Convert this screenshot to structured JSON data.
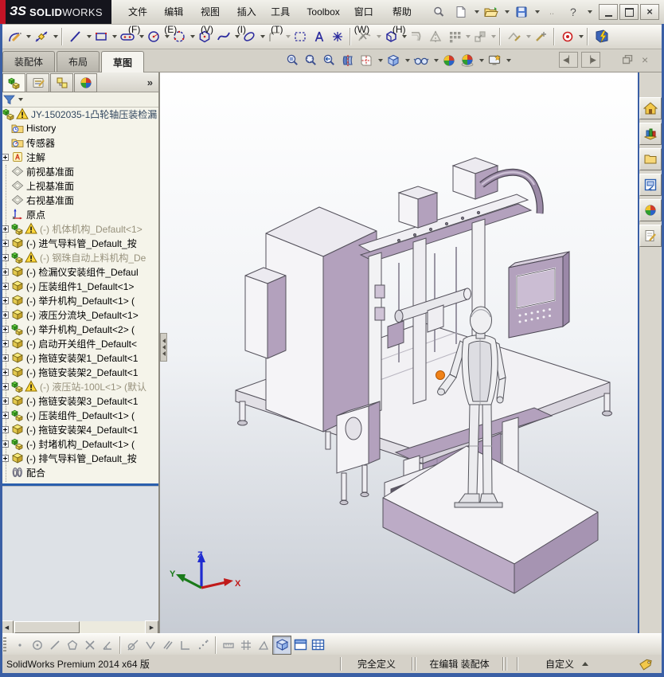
{
  "brand": {
    "mark": "ЗS",
    "name_bold": "SOLID",
    "name_light": "WORKS"
  },
  "menubar": {
    "items": [
      "文件(F)",
      "编辑(E)",
      "视图(V)",
      "插入(I)",
      "工具(T)",
      "Toolbox",
      "窗口(W)",
      "帮助(H)"
    ]
  },
  "quick_access_icons": [
    "search-icon",
    "new-document-icon",
    "open-icon",
    "save-icon",
    "overflow-icon",
    "help-icon"
  ],
  "window_controls": [
    "minimize",
    "maximize",
    "close"
  ],
  "sketch_toolbar_icons": [
    "sketch",
    "smart-dimension",
    "line",
    "corner-rectangle",
    "straight-slot",
    "circle",
    "perimeter-circle",
    "polygon",
    "spline",
    "ellipse",
    "sketch-fillet",
    "selection-box",
    "text",
    "point",
    "trim-entities",
    "convert-entities",
    "offset-entities",
    "mirror-entities",
    "linear-pattern",
    "move-entities",
    "display-relations",
    "repair-sketch",
    "quick-snaps",
    "instant2d"
  ],
  "command_tabs": {
    "items": [
      "装配体",
      "布局",
      "草图"
    ],
    "active": "草图"
  },
  "headsup_icons": [
    "zoom-to-fit",
    "zoom-to-area",
    "previous-view",
    "section-view",
    "view-orientation",
    "display-style",
    "hide-show-items",
    "edit-appearance",
    "apply-scene",
    "view-settings"
  ],
  "doc_window_controls": [
    "previous-window",
    "next-window",
    "minimize",
    "restore",
    "close"
  ],
  "feature_panel": {
    "tabs": [
      "featuremanager",
      "propertymanager",
      "configurationmanager",
      "displaymanager"
    ],
    "overflow": "»",
    "root": {
      "label": "JY-1502035-1凸轮轴压装检漏",
      "warning": true
    },
    "items": [
      {
        "label": "History",
        "icon": "history-folder"
      },
      {
        "label": "传感器",
        "icon": "sensors-folder"
      },
      {
        "label": "注解",
        "icon": "annotations",
        "expandable": true
      },
      {
        "label": "前视基准面",
        "icon": "plane"
      },
      {
        "label": "上视基准面",
        "icon": "plane"
      },
      {
        "label": "右视基准面",
        "icon": "plane"
      },
      {
        "label": "原点",
        "icon": "origin"
      },
      {
        "label": "(-) 机体机构_Default<1>",
        "icon": "subassembly",
        "warning": true,
        "suppressed_look": true,
        "expandable": true
      },
      {
        "label": "(-) 进气导料管_Default_按",
        "icon": "part",
        "expandable": true
      },
      {
        "label": "(-) 钢珠自动上料机构_De",
        "icon": "subassembly",
        "warning": true,
        "suppressed_look": true,
        "expandable": true
      },
      {
        "label": "(-) 检漏仪安装组件_Defaul",
        "icon": "part",
        "expandable": true
      },
      {
        "label": "(-) 压装组件1_Default<1>",
        "icon": "part",
        "expandable": true
      },
      {
        "label": "(-) 举升机构_Default<1> (",
        "icon": "part",
        "expandable": true
      },
      {
        "label": "(-) 液压分流块_Default<1>",
        "icon": "part",
        "expandable": true
      },
      {
        "label": "(-) 举升机构_Default<2> (",
        "icon": "subassembly",
        "expandable": true
      },
      {
        "label": "(-) 启动开关组件_Default<",
        "icon": "part",
        "expandable": true
      },
      {
        "label": "(-) 拖链安装架1_Default<1",
        "icon": "part",
        "expandable": true
      },
      {
        "label": "(-) 拖链安装架2_Default<1",
        "icon": "part",
        "expandable": true
      },
      {
        "label": "(-) 液压站-100L<1> (默认",
        "icon": "subassembly",
        "warning": true,
        "suppressed_look": true,
        "expandable": true
      },
      {
        "label": "(-) 拖链安装架3_Default<1",
        "icon": "part",
        "expandable": true
      },
      {
        "label": "(-) 压装组件_Default<1> (",
        "icon": "subassembly",
        "expandable": true
      },
      {
        "label": "(-) 拖链安装架4_Default<1",
        "icon": "part",
        "expandable": true
      },
      {
        "label": "(-) 封堵机构_Default<1> (",
        "icon": "subassembly",
        "expandable": true
      },
      {
        "label": "(-) 排气导料管_Default_按",
        "icon": "part",
        "expandable": true
      }
    ],
    "mates": {
      "label": "配合",
      "icon": "mates-paperclip"
    }
  },
  "taskpane_icons": [
    "solidworks-resources",
    "design-library",
    "file-explorer",
    "view-palette",
    "appearances-scenes",
    "custom-properties"
  ],
  "snap_toolbar_icons": [
    "sketch-point",
    "circle-snap",
    "line-snap",
    "polygon-snap",
    "intersection-snap",
    "angle-snap",
    "tangent-snap",
    "midpoint-snap",
    "parallel-snap",
    "perpendicular-snap",
    "trace-snap",
    "length-snap",
    "grid-snap",
    "angle-measure",
    "view-cube",
    "split-pane",
    "table-grid"
  ],
  "viewport": {
    "triad": {
      "x_label": "X",
      "y_label": "Y",
      "z_label": "Z"
    },
    "colors": {
      "model_lavender": "#b3a1bd",
      "model_light": "#f3f2f5",
      "highlight_orange": "#f08218",
      "triad_x": "#c01a1a",
      "triad_y": "#1a7a1a",
      "triad_z": "#1f2bd0"
    }
  },
  "statusbar": {
    "app_version": "SolidWorks Premium 2014 x64 版",
    "constraint_status": "完全定义",
    "edit_mode": "在编辑 装配体",
    "display_units": "自定义",
    "tag_icon": "tag-icon"
  }
}
